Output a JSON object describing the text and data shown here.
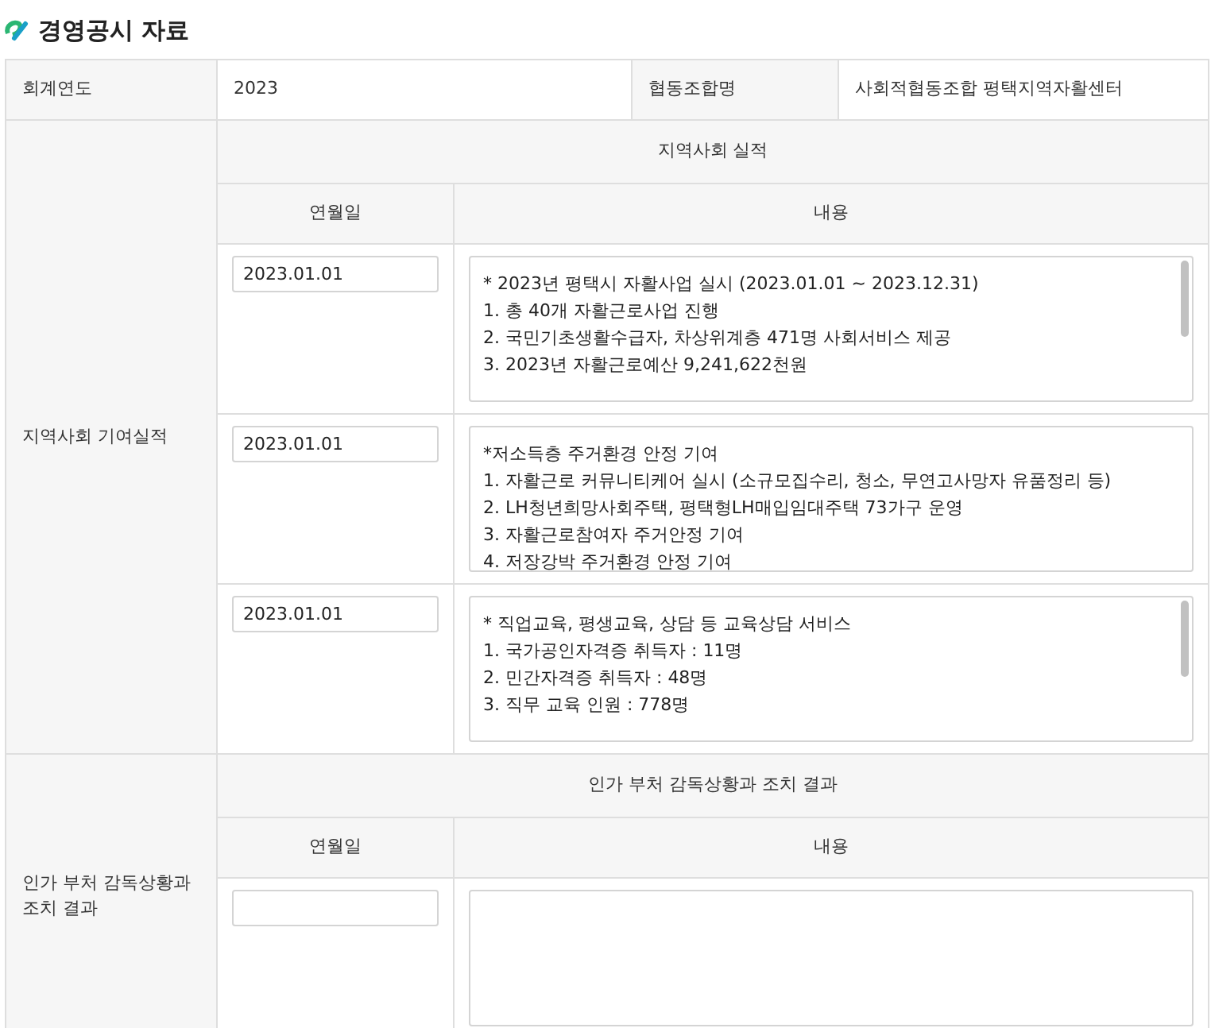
{
  "title": "경영공시 자료",
  "info": [
    {
      "label": "회계연도",
      "value": "2023"
    },
    {
      "label": "협동조합명",
      "value": "사회적협동조합 평택지역자활센터"
    }
  ],
  "sections": [
    {
      "label": "지역사회 기여실적",
      "heading": "지역사회 실적",
      "columns": [
        "연월일",
        "내용"
      ],
      "entries": [
        {
          "date": "2023.01.01",
          "content": "* 2023년 평택시 자활사업 실시 (2023.01.01 ~ 2023.12.31)\n1. 총 40개 자활근로사업 진행\n2. 국민기초생활수급자, 차상위계층 471명 사회서비스 제공\n3. 2023년 자활근로예산 9,241,622천원",
          "scrollable": true
        },
        {
          "date": "2023.01.01",
          "content": "*저소득층 주거환경 안정 기여\n1. 자활근로 커뮤니티케어 실시 (소규모집수리, 청소, 무연고사망자 유품정리 등)\n2. LH청년희망사회주택, 평택형LH매입임대주택 73가구 운영\n3. 자활근로참여자 주거안정 기여\n4. 저장강박 주거환경 안정 기여",
          "scrollable": false
        },
        {
          "date": "2023.01.01",
          "content": "* 직업교육, 평생교육, 상담 등 교육상담 서비스\n1. 국가공인자격증 취득자 : 11명\n2. 민간자격증 취득자 : 48명\n3. 직무 교육 인원 : 778명",
          "scrollable": true
        }
      ]
    },
    {
      "label": "인가 부처 감독상황과 조치 결과",
      "heading": "인가 부처 감독상황과 조치 결과",
      "columns": [
        "연월일",
        "내용"
      ],
      "entries": [
        {
          "scrollable": false
        }
      ]
    }
  ]
}
